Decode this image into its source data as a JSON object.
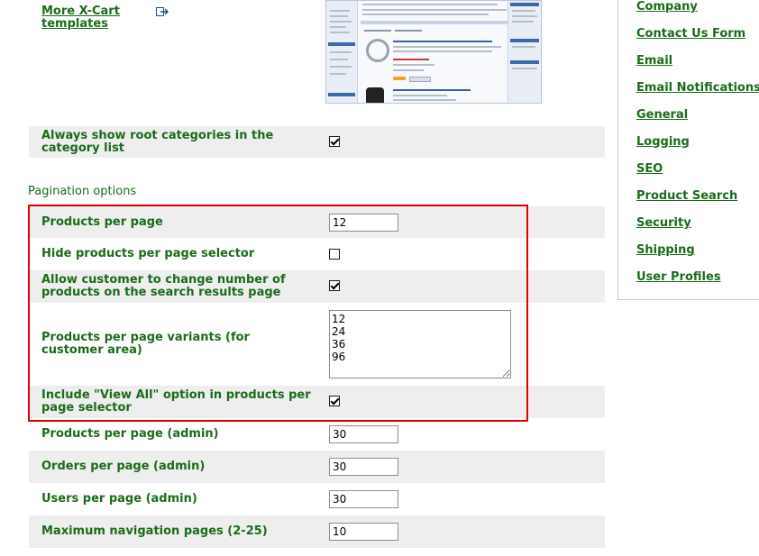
{
  "top_link": {
    "line1": "More X-Cart",
    "line2": "templates"
  },
  "icons": {
    "external_link": "external-link-icon"
  },
  "general": {
    "root_categories_label": "Always show root categories in the category list",
    "root_categories_checked": true
  },
  "pagination": {
    "heading": "Pagination options",
    "products_per_page": {
      "label": "Products per page",
      "value": "12"
    },
    "hide_selector": {
      "label": "Hide products per page selector",
      "checked": false
    },
    "allow_customer_change": {
      "label": "Allow customer to change number of products on the search results page",
      "checked": true
    },
    "variants": {
      "label": "Products per page variants (for customer area)",
      "value": "12\n24\n36\n96"
    },
    "view_all": {
      "label": "Include \"View All\" option in products per page selector",
      "checked": true
    },
    "products_admin": {
      "label": "Products per page (admin)",
      "value": "30"
    },
    "orders_admin": {
      "label": "Orders per page (admin)",
      "value": "30"
    },
    "users_admin": {
      "label": "Users per page (admin)",
      "value": "30"
    },
    "max_nav_pages": {
      "label": "Maximum navigation pages (2-25)",
      "value": "10"
    }
  },
  "sidebar": {
    "items": [
      {
        "label": "Company"
      },
      {
        "label": "Contact Us Form"
      },
      {
        "label": "Email"
      },
      {
        "label": "Email Notifications"
      },
      {
        "label": "General"
      },
      {
        "label": "Logging"
      },
      {
        "label": "SEO"
      },
      {
        "label": "Product Search"
      },
      {
        "label": "Security"
      },
      {
        "label": "Shipping"
      },
      {
        "label": "User Profiles"
      }
    ]
  },
  "colors": {
    "link_green": "#1b6b1b",
    "highlight_red": "#e00000",
    "row_shade": "#eeeeee"
  }
}
